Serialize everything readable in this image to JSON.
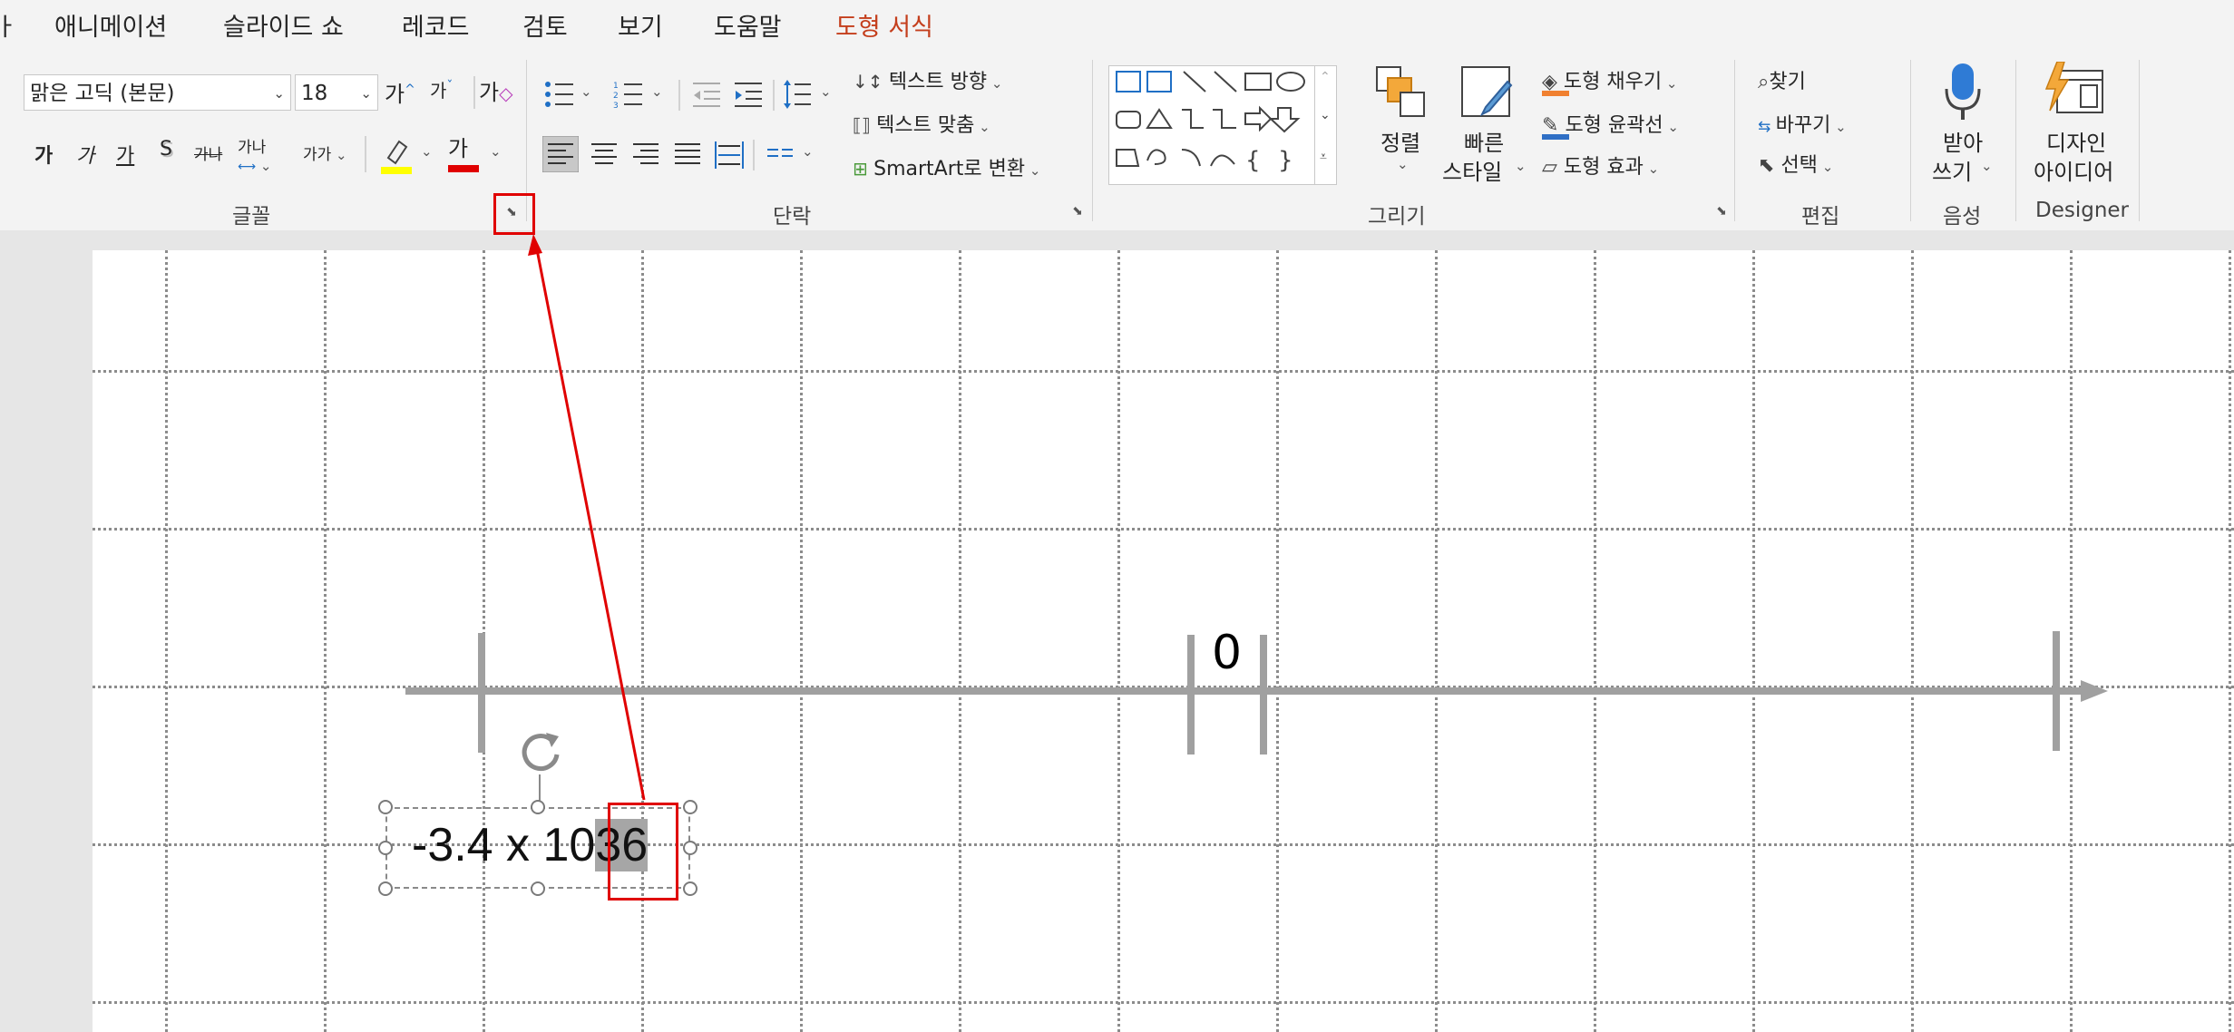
{
  "menu": {
    "partial_left": "ㅏ",
    "items": [
      "애니메이션",
      "슬라이드 쇼",
      "레코드",
      "검토",
      "보기",
      "도움말"
    ],
    "contextual_tab": "도형 서식"
  },
  "ribbon": {
    "font_group": {
      "label": "글꼴",
      "font_name": "맑은 고딕 (본문)",
      "font_size": "18",
      "increase_font": "가",
      "decrease_font": "가",
      "clear_format": "가",
      "bold": "가",
      "italic": "가",
      "underline": "가",
      "shadow": "S",
      "strikethrough": "가나",
      "char_spacing": "가나",
      "change_case": "가가",
      "font_color_glyph": "가",
      "highlight_color": "#ffff00",
      "font_color": "#e00000"
    },
    "paragraph_group": {
      "label": "단락",
      "text_direction": "텍스트 방향",
      "align_text": "텍스트 맞춤",
      "smartart": "SmartArt로 변환"
    },
    "drawing_group": {
      "label": "그리기",
      "arrange": "정렬",
      "quick_styles_1": "빠른",
      "quick_styles_2": "스타일",
      "shape_fill": "도형 채우기",
      "shape_outline": "도형 윤곽선",
      "shape_effects": "도형 효과"
    },
    "editing_group": {
      "label": "편집",
      "find": "찾기",
      "replace": "바꾸기",
      "select": "선택"
    },
    "voice_group": {
      "label": "음성",
      "dictate_1": "받아",
      "dictate_2": "쓰기"
    },
    "designer_group": {
      "label": "Designer",
      "designer_1": "디자인",
      "designer_2": "아이디어"
    }
  },
  "slide": {
    "zero_label": "0",
    "textbox": {
      "prefix": "-3.4 x 10",
      "selected_exponent": "36"
    }
  },
  "colors": {
    "accent_contextual": "#c43e1c",
    "annotation_red": "#e00000",
    "number_line_gray": "#a0a0a0"
  }
}
